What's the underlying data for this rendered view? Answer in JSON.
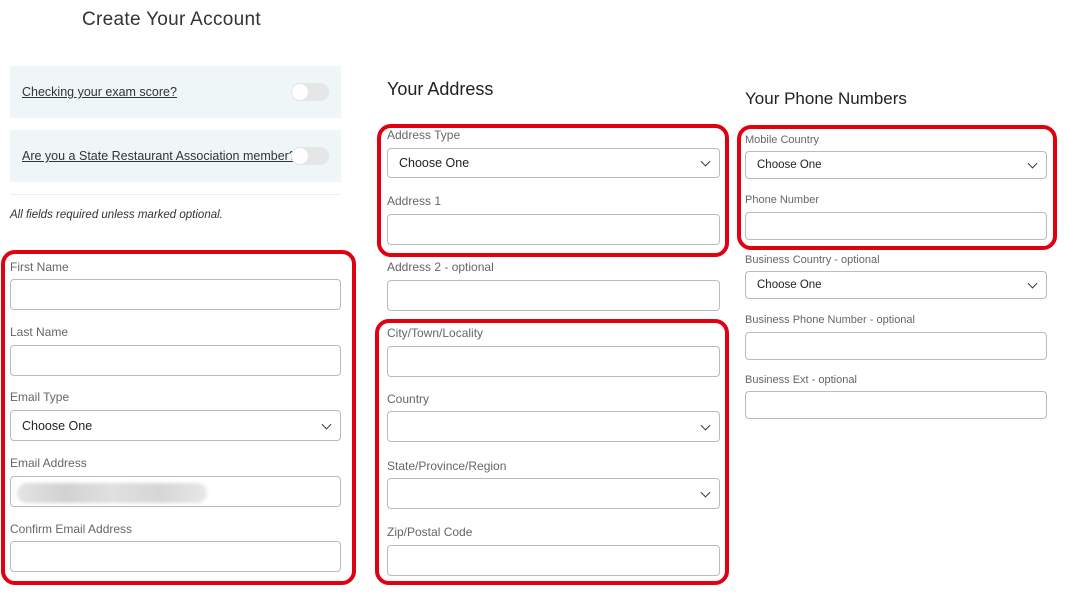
{
  "page": {
    "title": "Create Your Account"
  },
  "toggles": [
    {
      "label": "Checking your exam score?",
      "on": false
    },
    {
      "label": "Are you a State Restaurant Association member?",
      "on": false
    }
  ],
  "note": "All fields required unless marked optional.",
  "account": {
    "first_name": "First Name",
    "last_name": "Last Name",
    "email_type": "Email Type",
    "email_type_value": "Choose One",
    "email": "Email Address",
    "confirm_email": "Confirm Email Address"
  },
  "address": {
    "heading": "Your Address",
    "address_type": "Address Type",
    "address_type_value": "Choose One",
    "address1": "Address 1",
    "address2": "Address 2 - optional",
    "city": "City/Town/Locality",
    "country": "Country",
    "state": "State/Province/Region",
    "zip": "Zip/Postal Code"
  },
  "phone": {
    "heading": "Your Phone Numbers",
    "mobile_country": "Mobile Country",
    "mobile_country_value": "Choose One",
    "phone_number": "Phone Number",
    "business_country": "Business Country - optional",
    "business_country_value": "Choose One",
    "business_phone": "Business Phone Number - optional",
    "business_ext": "Business Ext - optional"
  }
}
